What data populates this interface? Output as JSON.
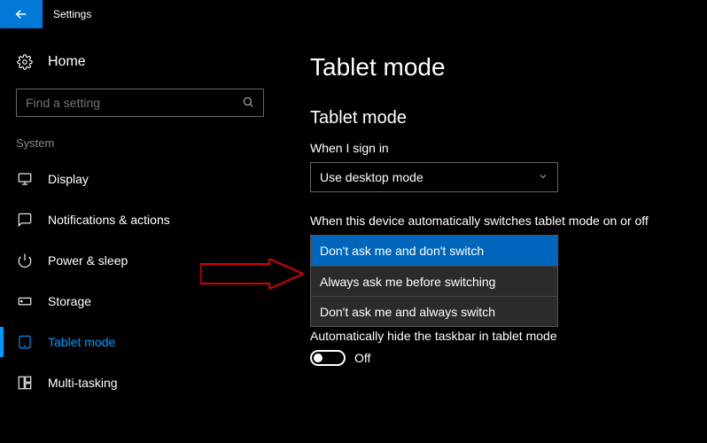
{
  "titlebar": {
    "app_title": "Settings"
  },
  "sidebar": {
    "home_label": "Home",
    "search_placeholder": "Find a setting",
    "group_label": "System",
    "items": [
      {
        "label": "Display"
      },
      {
        "label": "Notifications & actions"
      },
      {
        "label": "Power & sleep"
      },
      {
        "label": "Storage"
      },
      {
        "label": "Tablet mode"
      },
      {
        "label": "Multi-tasking"
      }
    ],
    "active_index": 4
  },
  "main": {
    "page_title": "Tablet mode",
    "section_title": "Tablet mode",
    "signin_label": "When I sign in",
    "signin_value": "Use desktop mode",
    "switch_label": "When this device automatically switches tablet mode on or off",
    "switch_options": [
      "Don't ask me and don't switch",
      "Always ask me before switching",
      "Don't ask me and always switch"
    ],
    "switch_selected_index": 0,
    "hide_taskbar_label": "Automatically hide the taskbar in tablet mode",
    "hide_taskbar_value": "Off"
  }
}
